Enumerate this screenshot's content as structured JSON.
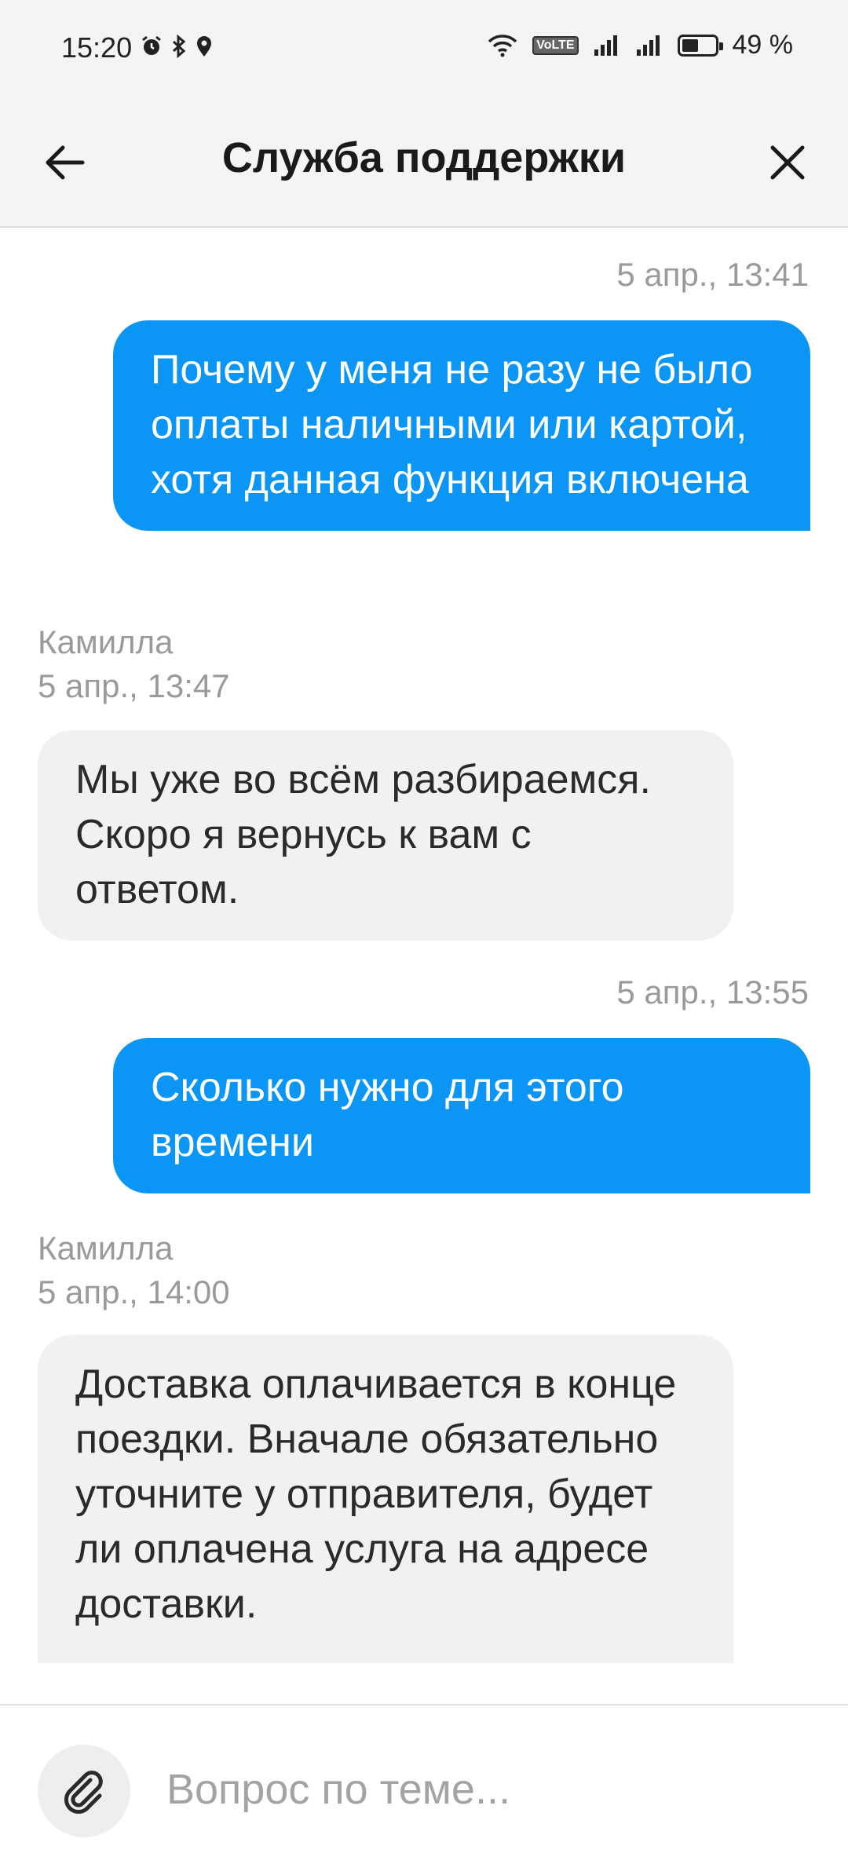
{
  "status_bar": {
    "time": "15:20",
    "battery": "49 %",
    "battery_level": 0.49,
    "network_badge": "VoLTE",
    "icons": [
      "alarm-icon",
      "bluetooth-icon",
      "location-icon",
      "wifi-icon",
      "signal-icon",
      "signal-icon",
      "battery-icon"
    ]
  },
  "header": {
    "title": "Служба поддержки",
    "back_icon": "arrow-left-icon",
    "close_icon": "close-icon"
  },
  "messages": [
    {
      "direction": "outgoing",
      "timestamp": "5 апр., 13:41",
      "text": "Почему у меня не разу не было оплаты наличными или картой, хотя данная функция включена"
    },
    {
      "direction": "incoming",
      "author": "Камилла",
      "timestamp": "5 апр., 13:47",
      "text": "Мы уже во всём разбираемся. Скоро я вернусь к вам с ответом."
    },
    {
      "direction": "outgoing",
      "timestamp": "5 апр., 13:55",
      "text": "Сколько нужно для этого времени"
    },
    {
      "direction": "incoming",
      "author": "Камилла",
      "timestamp": "5 апр., 14:00",
      "text": "Доставка оплачивается в конце поездки. Вначале обязательно уточните у отправителя, будет ли оплачена услуга на адресе доставки."
    }
  ],
  "input": {
    "placeholder": "Вопрос по теме...",
    "value": "",
    "attach_icon": "paperclip-icon"
  },
  "colors": {
    "outgoing_bubble": "#0b95f4",
    "incoming_bubble": "#f2f1f0",
    "header_bg": "#f5f4f2",
    "meta_text": "#9a9a9a"
  }
}
